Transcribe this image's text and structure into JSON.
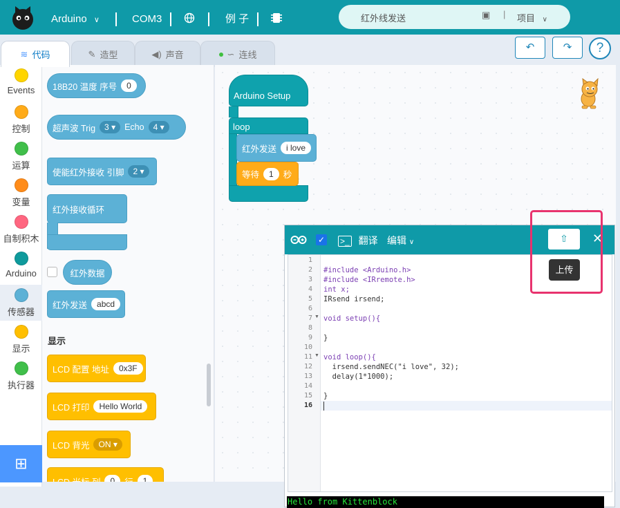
{
  "topbar": {
    "board": "Arduino",
    "port": "COM3",
    "examples": "例 子",
    "project_name": "红外线发送",
    "project_menu": "项目"
  },
  "tabs": [
    {
      "label": "代码"
    },
    {
      "label": "造型"
    },
    {
      "label": "声音"
    },
    {
      "label": "连线"
    }
  ],
  "categories": [
    {
      "label": "Events",
      "color": "#ffd500"
    },
    {
      "label": "控制",
      "color": "#ffab19"
    },
    {
      "label": "运算",
      "color": "#40bf4a"
    },
    {
      "label": "变量",
      "color": "#ff8c1a"
    },
    {
      "label": "自制积木",
      "color": "#ff6680"
    },
    {
      "label": "Arduino",
      "color": "#0e9a9c"
    },
    {
      "label": "传感器",
      "color": "#5cb1d6"
    },
    {
      "label": "显示",
      "color": "#ffbf00"
    },
    {
      "label": "执行器",
      "color": "#40bf4a"
    }
  ],
  "palette": {
    "ds18b20": {
      "label": "18B20 温度 序号",
      "value": "0"
    },
    "ultrasonic": {
      "label": "超声波 Trig",
      "trig": "3",
      "echo_label": "Echo",
      "echo": "4"
    },
    "ir_enable": {
      "label": "使能红外接收 引脚",
      "pin": "2"
    },
    "ir_loop": {
      "label": "红外接收循环"
    },
    "ir_data": {
      "label": "红外数据"
    },
    "ir_send": {
      "label": "红外发送",
      "value": "abcd"
    },
    "section_display": "显示",
    "lcd_config": {
      "label": "LCD 配置 地址",
      "value": "0x3F"
    },
    "lcd_print": {
      "label": "LCD 打印",
      "value": "Hello World"
    },
    "lcd_backlight": {
      "label": "LCD 背光",
      "value": "ON"
    },
    "lcd_cursor": {
      "label": "LCD 光标 列",
      "col": "0",
      "row_label": "行",
      "row": "1"
    }
  },
  "workspace": {
    "setup_label": "Arduino Setup",
    "loop_label": "loop",
    "ir_send_label": "红外发送",
    "ir_send_value": "i love",
    "wait_label": "等待",
    "wait_value": "1",
    "wait_unit": "秒"
  },
  "editor": {
    "translate_label": "翻译",
    "edit_menu": "编辑",
    "upload_tooltip": "上传",
    "code_lines": [
      "",
      "#include <Arduino.h>",
      "#include <IRremote.h>",
      "int x;",
      "IRsend irsend;",
      "",
      "void setup(){",
      "",
      "}",
      "",
      "void loop(){",
      "  irsend.sendNEC(\"i love\", 32);",
      "  delay(1*1000);",
      "",
      "}",
      ""
    ],
    "console_text": "Hello from Kittenblock"
  }
}
